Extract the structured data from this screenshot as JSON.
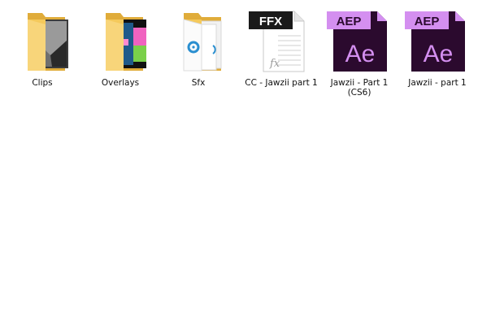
{
  "items": [
    {
      "label": "Clips",
      "icon": "folder-video-icon"
    },
    {
      "label": "Overlays",
      "icon": "folder-video-icon"
    },
    {
      "label": "Sfx",
      "icon": "folder-audio-icon"
    },
    {
      "label": "CC - Jawzii part 1",
      "icon": "ffx-file-icon",
      "badge": "FFX",
      "glyph": "fx"
    },
    {
      "label_line1": "Jawzii - Part 1",
      "label_line2": "(CS6)",
      "icon": "aep-file-icon",
      "badge": "AEP",
      "glyph": "Ae"
    },
    {
      "label": "Jawzii - part 1",
      "icon": "aep-file-icon",
      "badge": "AEP",
      "glyph": "Ae"
    }
  ],
  "colors": {
    "folder": "#f5c95b",
    "folder_dark": "#e0ac3a",
    "ae_bg": "#2b0a2e",
    "ae_accent": "#d48ff0",
    "ffx_badge": "#1a1a1a"
  }
}
